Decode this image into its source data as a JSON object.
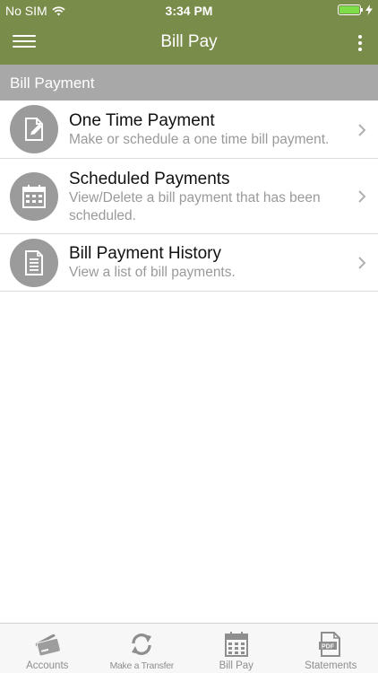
{
  "status_bar": {
    "carrier": "No SIM",
    "time": "3:34 PM"
  },
  "nav": {
    "title": "Bill Pay"
  },
  "section": {
    "title": "Bill Payment"
  },
  "items": [
    {
      "title": "One Time Payment",
      "desc": "Make or schedule a one time bill payment.",
      "icon": "edit-document-icon"
    },
    {
      "title": "Scheduled Payments",
      "desc": "View/Delete a bill payment that has been scheduled.",
      "icon": "calendar-icon"
    },
    {
      "title": "Bill Payment History",
      "desc": "View a list of bill payments.",
      "icon": "document-list-icon"
    }
  ],
  "tabs": [
    {
      "label": "Accounts",
      "icon": "cards-icon"
    },
    {
      "label": "Make a Transfer",
      "icon": "transfer-arrows-icon"
    },
    {
      "label": "Bill Pay",
      "icon": "calendar-icon"
    },
    {
      "label": "Statements",
      "icon": "pdf-icon"
    }
  ],
  "colors": {
    "brand": "#7a8c4a",
    "section": "#a8a8a8",
    "icon_circle": "#9b9b9b",
    "battery": "#7dde49"
  }
}
